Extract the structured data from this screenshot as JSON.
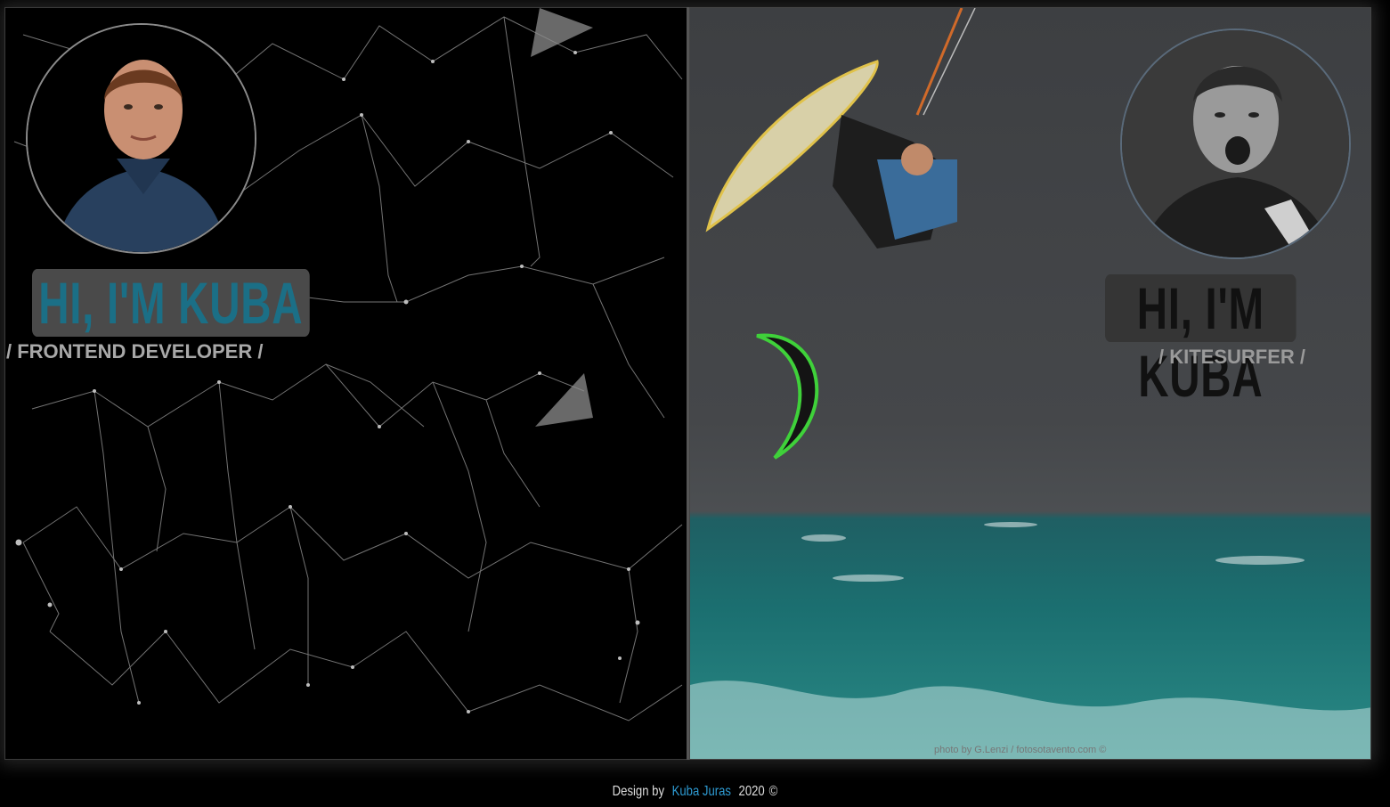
{
  "left_panel": {
    "title": "HI, I'M KUBA",
    "subtitle": "/ FRONTEND DEVELOPER /",
    "avatar_icon": "person-portrait-icon",
    "background": "network-particles"
  },
  "right_panel": {
    "title": "HI, I'M KUBA",
    "subtitle": "/ KITESURFER /",
    "avatar_icon": "kitesurfer-portrait-icon",
    "photo_credit": "photo by G.Lenzi / fotosotavento.com ©"
  },
  "footer": {
    "prefix": "Design by",
    "author": "Kuba Juras",
    "year": "2020",
    "copyright": "©"
  },
  "colors": {
    "accent": "#2e9bd3",
    "title_left": "#1b6f86",
    "background": "#000000"
  }
}
